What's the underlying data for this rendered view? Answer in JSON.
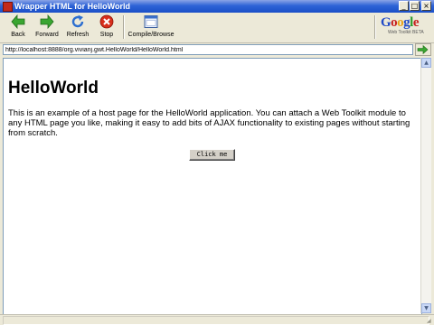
{
  "window": {
    "title": "Wrapper HTML for HelloWorld"
  },
  "titlebar_buttons": {
    "minimize": "_",
    "maximize": "□",
    "close": "×"
  },
  "toolbar": {
    "back_label": "Back",
    "forward_label": "Forward",
    "refresh_label": "Refresh",
    "stop_label": "Stop",
    "compile_label": "Compile/Browse"
  },
  "logo": {
    "text": "Google",
    "subtitle": "Web Toolkit BETA"
  },
  "address": {
    "url": "http://localhost:8888/org.vivianj.gwt.HelloWorld/HelloWorld.html"
  },
  "page": {
    "heading": "HelloWorld",
    "body": "This is an example of a host page for the HelloWorld application. You can attach a Web Toolkit module to any HTML page you like, making it easy to add bits of AJAX functionality to existing pages without starting from scratch.",
    "button_label": "Click me"
  },
  "scrollbar": {
    "up": "▲",
    "down": "▼"
  },
  "icons": {
    "back": "back-arrow-icon",
    "forward": "forward-arrow-icon",
    "refresh": "refresh-icon",
    "stop": "stop-icon",
    "compile": "compile-browse-icon",
    "go": "go-arrow-icon"
  },
  "colors": {
    "titlebar": "#2e63d6",
    "back_forward": "#3aa631",
    "refresh": "#2d6fd0",
    "stop": "#d72e1b"
  }
}
